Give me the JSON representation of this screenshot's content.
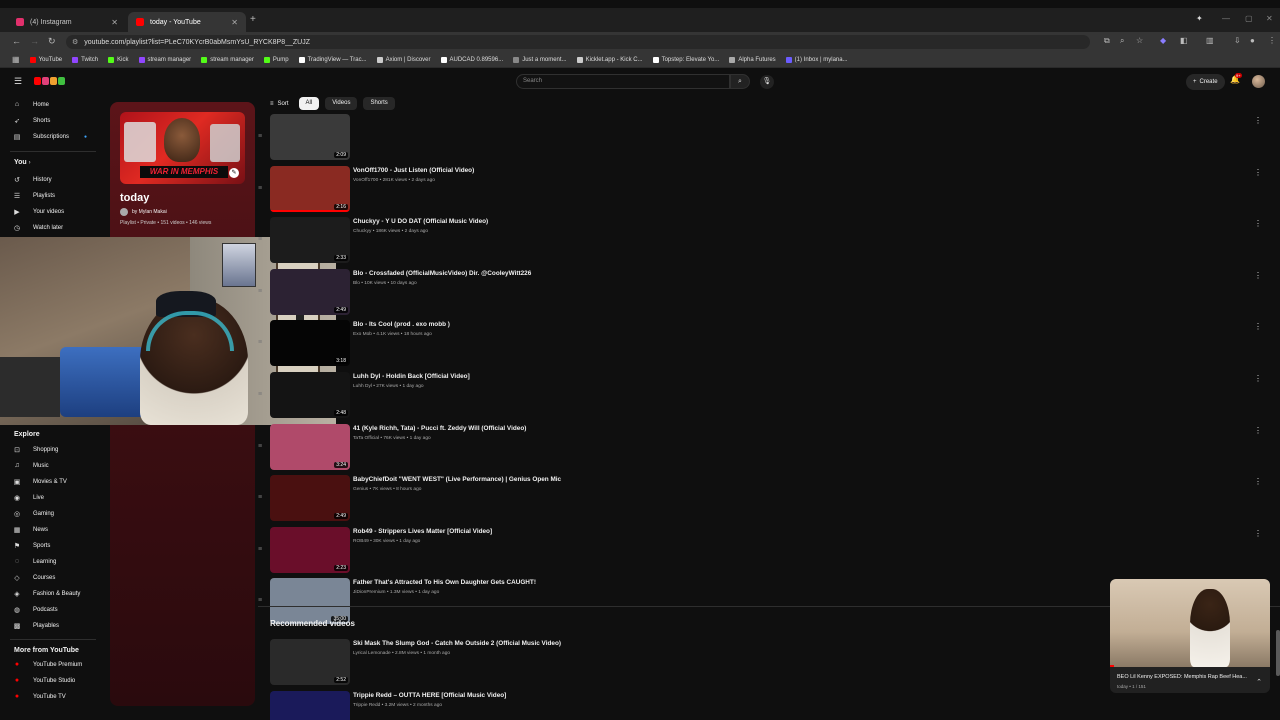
{
  "browser": {
    "tabs": [
      {
        "title": "(4) Instagram",
        "active": false,
        "color": "#e1306c"
      },
      {
        "title": "today - YouTube",
        "active": true,
        "color": "#ff0000"
      }
    ],
    "url": "youtube.com/playlist?list=PLeC70KYcrB0abMsmYsU_RYCK8P8__ZUJZ",
    "bookmarks": [
      {
        "label": "YouTube",
        "color": "#ff0000"
      },
      {
        "label": "Twitch",
        "color": "#9146ff"
      },
      {
        "label": "Kick",
        "color": "#53fc18"
      },
      {
        "label": "stream manager",
        "color": "#9146ff"
      },
      {
        "label": "stream manager",
        "color": "#53fc18"
      },
      {
        "label": "Pump",
        "color": "#53fc18"
      },
      {
        "label": "TradingView — Trac...",
        "color": "#ffffff"
      },
      {
        "label": "Axiom | Discover",
        "color": "#cccccc"
      },
      {
        "label": "AUDCAD 0.89596...",
        "color": "#ffffff"
      },
      {
        "label": "Just a moment...",
        "color": "#888888"
      },
      {
        "label": "Kicklet.app - Kick C...",
        "color": "#cccccc"
      },
      {
        "label": "Topstep: Elevate Yo...",
        "color": "#ffffff"
      },
      {
        "label": "Alpha Futures",
        "color": "#aaaaaa"
      },
      {
        "label": "(1) Inbox | mylana...",
        "color": "#6b5cff"
      }
    ]
  },
  "masthead": {
    "search_placeholder": "Search",
    "create_label": "Create",
    "notif_count": "9+"
  },
  "sidebar": {
    "main": [
      {
        "label": "Home",
        "icon": "home-icon",
        "glyph": "⌂"
      },
      {
        "label": "Shorts",
        "icon": "shorts-icon",
        "glyph": "➶"
      },
      {
        "label": "Subscriptions",
        "icon": "subscriptions-icon",
        "glyph": "▤"
      }
    ],
    "you_label": "You",
    "you": [
      {
        "label": "History",
        "icon": "history-icon",
        "glyph": "↺"
      },
      {
        "label": "Playlists",
        "icon": "playlists-icon",
        "glyph": "☰"
      },
      {
        "label": "Your videos",
        "icon": "your-videos-icon",
        "glyph": "▶"
      },
      {
        "label": "Watch later",
        "icon": "watch-later-icon",
        "glyph": "◷"
      }
    ],
    "explore_label": "Explore",
    "explore": [
      {
        "label": "Shopping",
        "icon": "shopping-icon",
        "glyph": "⊡"
      },
      {
        "label": "Music",
        "icon": "music-icon",
        "glyph": "♫"
      },
      {
        "label": "Movies & TV",
        "icon": "movies-icon",
        "glyph": "▣"
      },
      {
        "label": "Live",
        "icon": "live-icon",
        "glyph": "◉"
      },
      {
        "label": "Gaming",
        "icon": "gaming-icon",
        "glyph": "◎"
      },
      {
        "label": "News",
        "icon": "news-icon",
        "glyph": "▦"
      },
      {
        "label": "Sports",
        "icon": "sports-icon",
        "glyph": "⚑"
      },
      {
        "label": "Learning",
        "icon": "learning-icon",
        "glyph": "◌"
      },
      {
        "label": "Courses",
        "icon": "courses-icon",
        "glyph": "◇"
      },
      {
        "label": "Fashion & Beauty",
        "icon": "fashion-icon",
        "glyph": "◈"
      },
      {
        "label": "Podcasts",
        "icon": "podcasts-icon",
        "glyph": "◍"
      },
      {
        "label": "Playables",
        "icon": "playables-icon",
        "glyph": "▩"
      }
    ],
    "more_label": "More from YouTube",
    "more": [
      {
        "label": "YouTube Premium",
        "icon": "youtube-premium-icon",
        "color": "#ff0000"
      },
      {
        "label": "YouTube Studio",
        "icon": "youtube-studio-icon",
        "color": "#ff0000"
      },
      {
        "label": "YouTube TV",
        "icon": "youtube-tv-icon",
        "color": "#ff0000"
      }
    ]
  },
  "playlist": {
    "title": "today",
    "owner": "by Mylan Makai",
    "meta": "Playlist • Private • 151 videos • 146 views",
    "thumb_banner": "WAR IN MEMPHIS"
  },
  "chips": {
    "sort": "Sort",
    "items": [
      {
        "label": "All",
        "selected": true
      },
      {
        "label": "Videos",
        "selected": false
      },
      {
        "label": "Shorts",
        "selected": false
      }
    ]
  },
  "videos": [
    {
      "title": "",
      "meta": "",
      "duration": "2:09",
      "thumb": "#3a3a3a",
      "progress": 0
    },
    {
      "title": "VonOff1700 - Just Listen (Official Video)",
      "meta": "VonOff1700 • 281K views • 2 days ago",
      "duration": "2:16",
      "thumb": "#8a2a22",
      "progress": 1
    },
    {
      "title": "Chuckyy - Y U DO DAT (Official Music Video)",
      "meta": "Chuckyy • 186K views • 2 days ago",
      "duration": "2:33",
      "thumb": "#1c1c1c",
      "progress": 0
    },
    {
      "title": "Blo - Crossfaded (OfficialMusicVideo) Dir. @CooleyWitt226",
      "meta": "Blo • 10K views • 10 days ago",
      "duration": "2:49",
      "thumb": "#2c2233",
      "progress": 0
    },
    {
      "title": "Blo - Its Cool (prod . exo mobb )",
      "meta": "Exo Mob • 4.1K views • 18 hours ago",
      "duration": "3:18",
      "thumb": "#050505",
      "progress": 0
    },
    {
      "title": "Luhh Dyl - Holdin Back [Official Video]",
      "meta": "Luhh Dyl • 27K views • 1 day ago",
      "duration": "2:48",
      "thumb": "#141414",
      "progress": 0
    },
    {
      "title": "41 (Kyle Richh, Tata) - Pucci ft. Zeddy Will (Official Video)",
      "meta": "TaTa Official • 76K views • 1 day ago",
      "duration": "3:24",
      "thumb": "#b04a6a",
      "progress": 0
    },
    {
      "title": "BabyChiefDoit \"WENT WEST\" (Live Performance) | Genius Open Mic",
      "meta": "Genius • 7K views • 8 hours ago",
      "duration": "2:49",
      "thumb": "#4a1010",
      "progress": 0
    },
    {
      "title": "Rob49 - Strippers Lives Matter [Official Video]",
      "meta": "ROB49 • 30K views • 1 day ago",
      "duration": "2:23",
      "thumb": "#6a0e2a",
      "progress": 0
    },
    {
      "title": "Father That's Attracted To His Own Daughter Gets CAUGHT!",
      "meta": "JiDionPremium • 1.3M views • 1 day ago",
      "duration": "35:00",
      "thumb": "#7a8696",
      "progress": 0
    }
  ],
  "recommended_label": "Recommended videos",
  "recommended": [
    {
      "title": "Ski Mask The Slump God - Catch Me Outside 2 (Official Music Video)",
      "meta": "Lyrical Lemonade • 2.8M views • 1 month ago",
      "duration": "2:52",
      "thumb": "#2a2a2a"
    },
    {
      "title": "Trippie Redd – OUTTA HERE [Official Music Video]",
      "meta": "Trippie Redd • 3.2M views • 2 months ago",
      "duration": "",
      "thumb": "#1a1a5a"
    }
  ],
  "miniplayer": {
    "title": "BEO Lil Kenny EXPOSED: Memphis Rap Beef Hea...",
    "sub": "today • 1 / 151"
  }
}
